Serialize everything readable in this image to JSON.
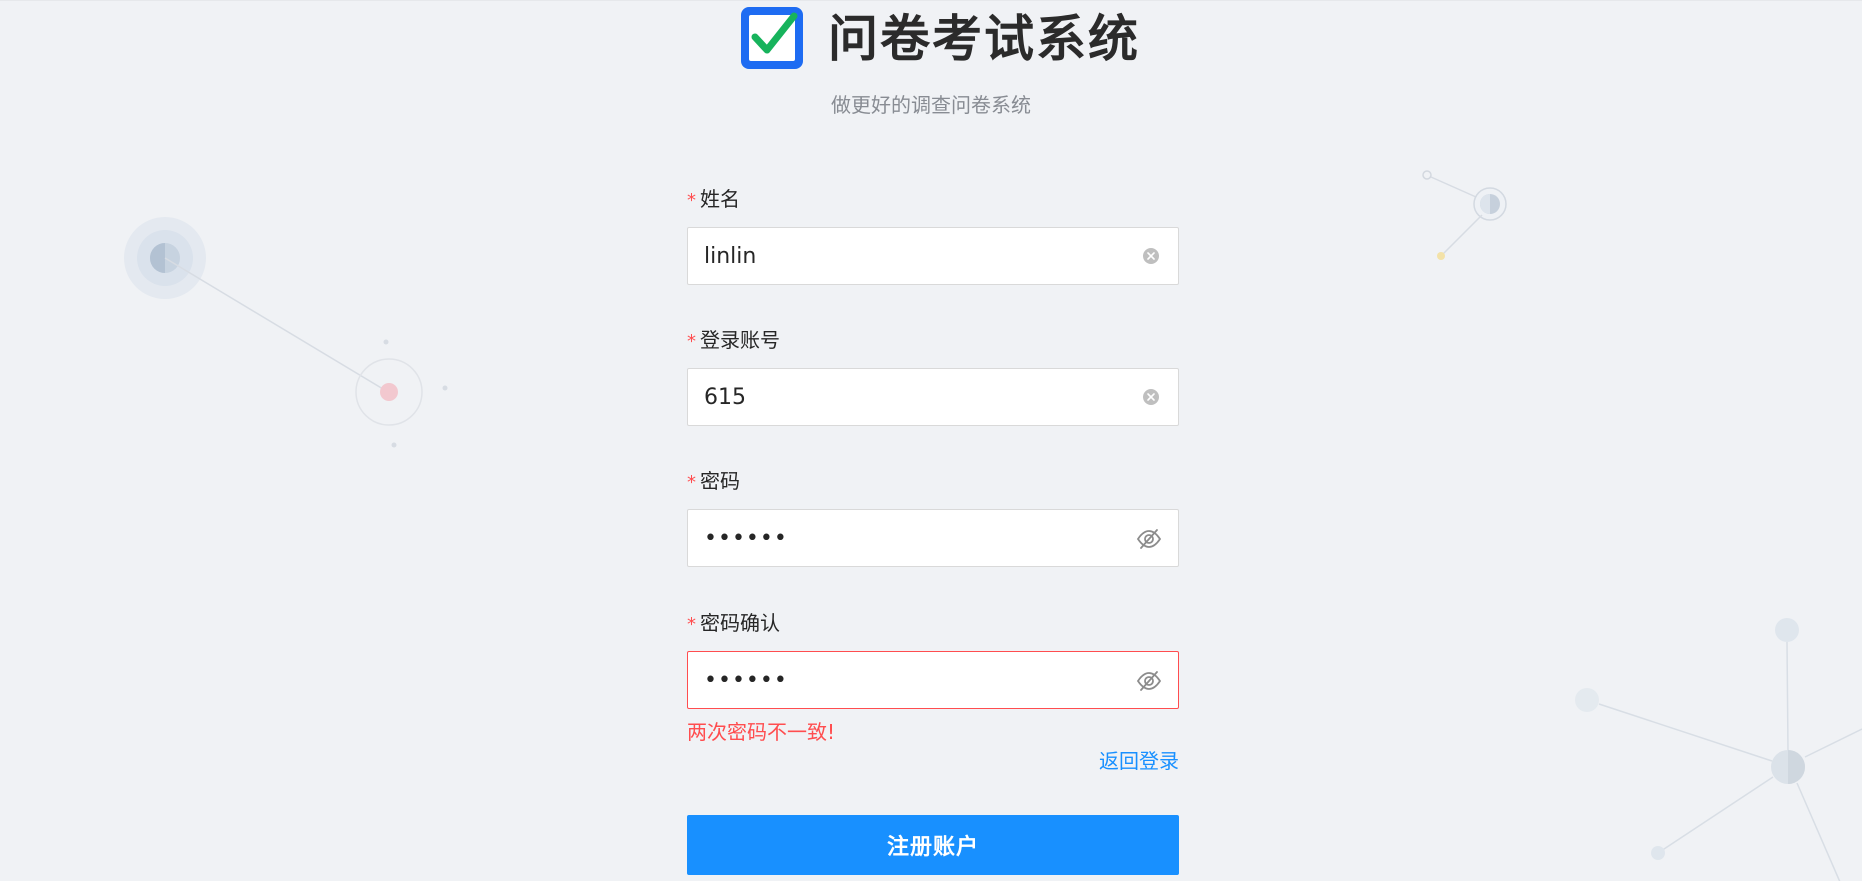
{
  "header": {
    "title": "问卷考试系统",
    "subtitle": "做更好的调查问卷系统",
    "logo_icon": "checkbox-checked-icon"
  },
  "form": {
    "required_mark": "*",
    "fields": [
      {
        "label": "姓名",
        "value": "linlin",
        "type": "text",
        "icon": "clear-icon"
      },
      {
        "label": "登录账号",
        "value": "615",
        "type": "text",
        "icon": "clear-icon"
      },
      {
        "label": "密码",
        "value": "123456",
        "type": "password",
        "icon": "eye-invisible-icon"
      },
      {
        "label": "密码确认",
        "value": "654321",
        "type": "password",
        "icon": "eye-invisible-icon",
        "error": "两次密码不一致!"
      }
    ],
    "back_link": "返回登录",
    "submit_label": "注册账户"
  },
  "colors": {
    "primary": "#1890ff",
    "error": "#ff4d4f",
    "background": "#f0f2f5",
    "logo_blue": "#1e6cf2",
    "logo_green": "#17b35c"
  }
}
